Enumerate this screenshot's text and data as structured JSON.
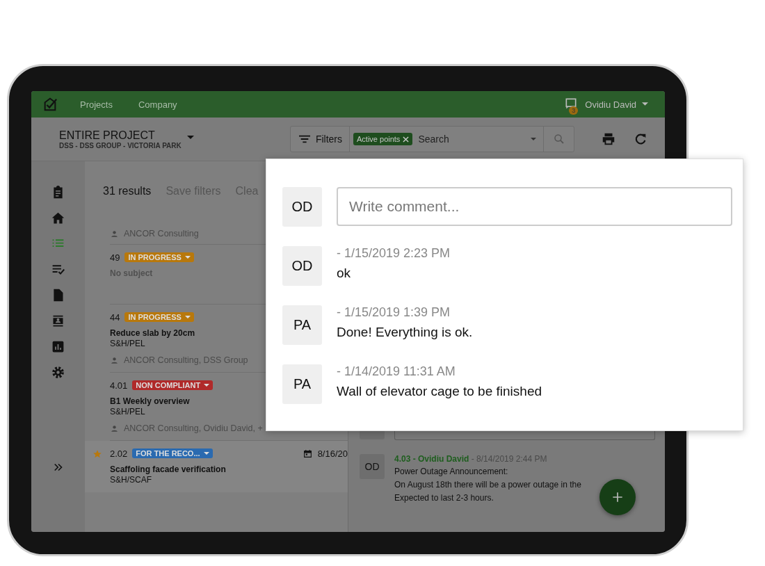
{
  "header": {
    "nav": [
      "Projects",
      "Company"
    ],
    "notification_count": "3",
    "user": "Ovidiu David"
  },
  "project": {
    "title": "ENTIRE PROJECT",
    "subtitle": "DSS - DSS GROUP - VICTORIA PARK"
  },
  "filter_bar": {
    "filters_label": "Filters",
    "chips": [
      "Active points"
    ],
    "search_placeholder": "Search"
  },
  "sidebar": {
    "items": [
      {
        "selected": false
      },
      {
        "selected": false
      },
      {
        "selected": true
      },
      {
        "selected": false
      },
      {
        "selected": false
      },
      {
        "selected": false
      },
      {
        "selected": false
      },
      {
        "selected": false
      }
    ]
  },
  "results": {
    "count": "31 results",
    "save_filters": "Save filters",
    "clear": "Clea"
  },
  "points": [
    {
      "assignees": "ANCOR Consulting",
      "starred": false,
      "selected": false
    },
    {
      "number": "49",
      "status": {
        "label": "IN PROGRESS",
        "color": "#b8780c"
      },
      "subject": "No subject",
      "has_subject": false,
      "starred": false,
      "selected": false
    },
    {
      "number": "44",
      "status": {
        "label": "IN PROGRESS",
        "color": "#b8780c"
      },
      "subject": "Reduce slab by 20cm",
      "has_subject": true,
      "category": "S&H/PEL",
      "assignees": "ANCOR Consulting, DSS Group",
      "starred": false,
      "selected": false
    },
    {
      "number": "4.01",
      "status": {
        "label": "NON COMPLIANT",
        "color": "#b02a2a"
      },
      "subject": "B1 Weekly overview",
      "has_subject": true,
      "category": "S&H/PEL",
      "assignees": "ANCOR Consulting, Ovidiu David, +",
      "starred": false,
      "selected": false
    },
    {
      "number": "2.02",
      "status": {
        "label": "FOR THE RECO...",
        "color": "#2a6ab0"
      },
      "due_date": "8/16/20",
      "subject": "Scaffoling facade verification",
      "has_subject": true,
      "category": "S&H/SCAF",
      "starred": true,
      "selected": true
    }
  ],
  "comments_panel": {
    "comments": [
      {
        "avatar": "OD",
        "reference": "4.03 - Ovidiu David",
        "time": "- 8/14/2019 2:44 PM",
        "lines": [
          "Power Outage Announcement:",
          "On August 18th there will be a power outage in the",
          "Expected to last 2-3 hours."
        ]
      }
    ]
  },
  "comment_popup": {
    "new_comment": {
      "avatar": "OD",
      "placeholder": "Write comment..."
    },
    "comments": [
      {
        "avatar": "OD",
        "time": "- 1/15/2019 2:23 PM",
        "text": "ok"
      },
      {
        "avatar": "PA",
        "time": "- 1/15/2019 1:39 PM",
        "text": "Done! Everything is ok."
      },
      {
        "avatar": "PA",
        "time": "- 1/14/2019 11:31 AM",
        "text": "Wall of elevator cage to be finished"
      }
    ]
  }
}
